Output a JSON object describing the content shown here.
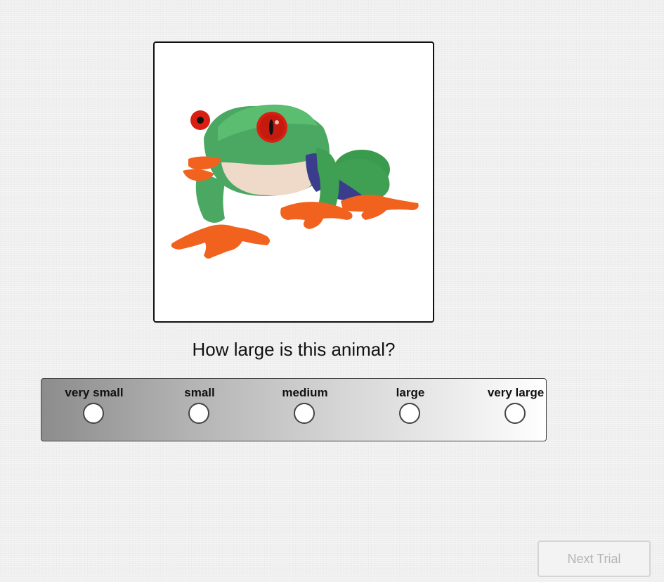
{
  "stimulus": {
    "image_subject": "red-eyed tree frog"
  },
  "question": "How large is this animal?",
  "scale": {
    "options": [
      {
        "label": "very small",
        "selected": false
      },
      {
        "label": "small",
        "selected": false
      },
      {
        "label": "medium",
        "selected": false
      },
      {
        "label": "large",
        "selected": false
      },
      {
        "label": "very large",
        "selected": false
      }
    ]
  },
  "next_button": {
    "label": "Next Trial",
    "enabled": false
  },
  "colors": {
    "frog_body": "#3fa35b",
    "frog_eye": "#d81f12",
    "frog_feet": "#f0621d",
    "frog_belly": "#efd9c8",
    "frog_flank": "#3a3d8c"
  }
}
